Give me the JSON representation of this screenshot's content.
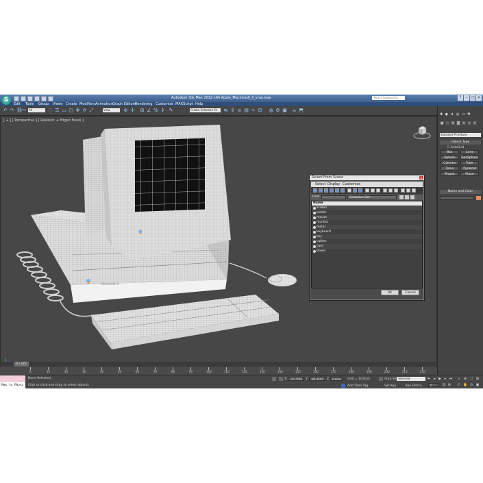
{
  "window": {
    "title": "Autodesk 3ds Max  2012 x64      Apple_Macintosh_II_vray.max",
    "search_placeholder": "Type a keyword or phrase",
    "logo_text": "S"
  },
  "menu": [
    "Edit",
    "Tools",
    "Group",
    "Views",
    "Create",
    "Modifiers",
    "Animation",
    "Graph Editors",
    "Rendering",
    "Customize",
    "MAXScript",
    "Help"
  ],
  "toolbar": {
    "selection_filter": "All",
    "reference_coord": "View",
    "named_selection": "Create Selection Se"
  },
  "viewport": {
    "label": "[ + ] [ Perspective ] [ Realistic + Edged Faces ]"
  },
  "command_panel": {
    "tab_icons": [
      "create-icon",
      "modify-icon",
      "hierarchy-icon",
      "motion-icon",
      "display-icon",
      "utilities-icon"
    ],
    "category_dropdown": "Standard Primitives",
    "object_type_header": "Object Type",
    "autogrid_label": "AutoGrid",
    "buttons": [
      "Box",
      "Cone",
      "Sphere",
      "GeoSphere",
      "Cylinder",
      "Tube",
      "Torus",
      "Pyramid",
      "Teapot",
      "Plane"
    ],
    "name_color_header": "Name and Color",
    "swatch_color": "#e28d5b"
  },
  "dialog": {
    "title": "Select From Scene",
    "close_label": "x",
    "menu": [
      "Select",
      "Display",
      "Customize"
    ],
    "find_label": "Find:",
    "selection_set_label": "Selection Set:",
    "column_header": "Name",
    "objects": [
      "screen",
      "plastic",
      "mouse",
      "monitor",
      "metal",
      "keyboard",
      "key",
      "cables",
      "cord",
      "Boxes"
    ],
    "ok_label": "OK",
    "cancel_label": "Cancel"
  },
  "timeline": {
    "slider_label": "0 / 225",
    "ticks": [
      "0",
      "10",
      "20",
      "30",
      "40",
      "50",
      "60",
      "70",
      "80",
      "90",
      "100",
      "110",
      "120",
      "130",
      "140",
      "150",
      "160",
      "170",
      "180",
      "190",
      "200",
      "210",
      "220"
    ]
  },
  "statusbar": {
    "maxscript_text": "Max to Physc",
    "selection_status": "None Selected",
    "prompt": "Click or click-and-drag to select objects",
    "x_value": "-76.7266",
    "y_value": "-85.4505",
    "z_value": "0.0cm",
    "grid_label": "Grid = 10.0cm",
    "add_time_tag": "Add Time Tag",
    "auto_key_label": "Auto Key",
    "set_key_label": "Set Key",
    "selected_dropdown": "Selected",
    "key_filters_label": "Key Filters...",
    "frame_value": "0"
  }
}
